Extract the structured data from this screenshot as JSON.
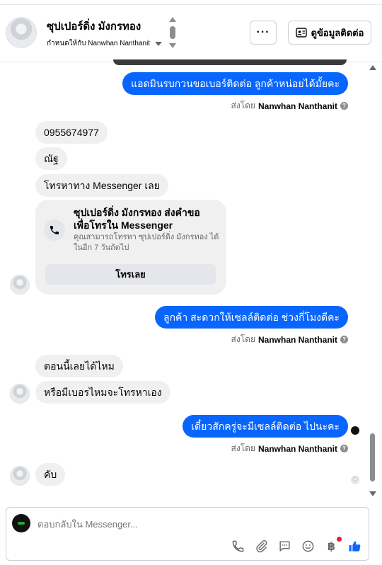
{
  "header": {
    "contact_name": "ซุปเปอร์ดิ่ง มังกรทอง",
    "assigned_to": "กำหนดให้กับ Nanwhan Nanthanit",
    "more_label": "···",
    "contact_info_label": "ดูข้อมูลติดต่อ"
  },
  "messages": {
    "m1": "แอดมินรบกวนขอเบอร์ติดต่อ ลูกค้าหน่อยได้มั้ยคะ",
    "m2": "0955674977",
    "m3": "ณัฐ",
    "m4": "โทรหาทาง Messenger เลย",
    "m5": "ลูกค้า สะดวกให้เซลล์ติดต่อ ช่วงกี่โมงดีคะ",
    "m6": "ตอนนี้เลยได้ไหม",
    "m7": "หรือมีเบอรไหมจะโทรหาเอง",
    "m8": "เดี๋ยวสักครู่จะมีเซลล์ติดต่อ ไปนะคะ",
    "m9": "คับ"
  },
  "sent_by": {
    "prefix": "ส่งโดย",
    "agent": "Nanwhan Nanthanit"
  },
  "call_card": {
    "title": "ซุปเปอร์ดิ่ง มังกรทอง ส่งคำขอเพื่อโทรใน Messenger",
    "description": "คุณสามารถโทรหา ซุปเปอร์ดิ่ง มังกรทอง ได้ในอีก 7 วันถัดไป",
    "button_label": "โทรเลย"
  },
  "composer": {
    "placeholder": "ตอบกลับใน Messenger..."
  },
  "icons": [
    "phone-icon",
    "attach-icon",
    "saved-replies-icon",
    "emoji-icon",
    "baht-payment-icon",
    "like-icon",
    "info-icon",
    "contact-card-icon"
  ],
  "colors": {
    "outgoing_bubble": "#0866ff",
    "incoming_bubble": "#f0f0f0",
    "like_icon": "#0866ff",
    "notification_dot": "#e41e3f"
  }
}
